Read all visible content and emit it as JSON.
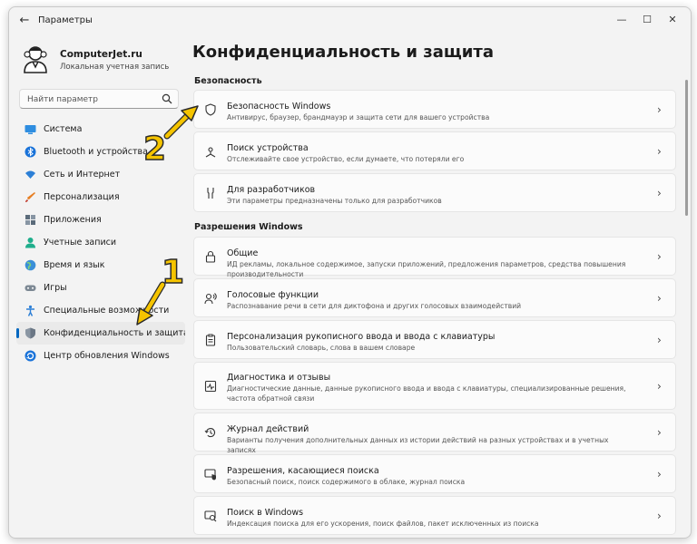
{
  "window": {
    "title": "Параметры",
    "back_icon": "back-arrow-icon",
    "controls": [
      "minimize-icon",
      "maximize-icon",
      "close-icon"
    ]
  },
  "profile": {
    "name": "ComputerJet.ru",
    "account_type": "Локальная учетная запись"
  },
  "search": {
    "placeholder": "Найти параметр"
  },
  "sidebar": {
    "items": [
      {
        "label": "Система",
        "icon": "system-icon"
      },
      {
        "label": "Bluetooth и устройства",
        "icon": "bluetooth-icon"
      },
      {
        "label": "Сеть и Интернет",
        "icon": "wifi-icon"
      },
      {
        "label": "Персонализация",
        "icon": "brush-icon"
      },
      {
        "label": "Приложения",
        "icon": "apps-icon"
      },
      {
        "label": "Учетные записи",
        "icon": "accounts-icon"
      },
      {
        "label": "Время и язык",
        "icon": "globe-icon"
      },
      {
        "label": "Игры",
        "icon": "gamepad-icon"
      },
      {
        "label": "Специальные возможности",
        "icon": "accessibility-icon"
      },
      {
        "label": "Конфиденциальность и защита",
        "icon": "shield-icon",
        "active": true
      },
      {
        "label": "Центр обновления Windows",
        "icon": "update-icon"
      }
    ]
  },
  "main": {
    "title": "Конфиденциальность и защита",
    "sections": [
      {
        "header": "Безопасность",
        "cards": [
          {
            "title": "Безопасность Windows",
            "desc": "Антивирус, браузер, брандмауэр и защита сети для вашего устройства",
            "icon": "shield-icon"
          },
          {
            "title": "Поиск устройства",
            "desc": "Отслеживайте свое устройство, если думаете, что потеряли его",
            "icon": "find-device-icon"
          },
          {
            "title": "Для разработчиков",
            "desc": "Эти параметры предназначены только для разработчиков",
            "icon": "developer-tools-icon"
          }
        ]
      },
      {
        "header": "Разрешения Windows",
        "cards": [
          {
            "title": "Общие",
            "desc": "ИД рекламы, локальное содержимое, запуски приложений, предложения параметров, средства повышения производительности",
            "icon": "lock-icon"
          },
          {
            "title": "Голосовые функции",
            "desc": "Распознавание речи в сети для диктофона и других голосовых взаимодействий",
            "icon": "speech-icon"
          },
          {
            "title": "Персонализация рукописного ввода и ввода с клавиатуры",
            "desc": "Пользовательский словарь, слова в вашем словаре",
            "icon": "clipboard-icon"
          },
          {
            "title": "Диагностика и отзывы",
            "desc": "Диагностические данные, данные рукописного ввода и ввода с клавиатуры, специализированные решения, частота обратной связи",
            "icon": "diagnostics-icon"
          },
          {
            "title": "Журнал действий",
            "desc": "Варианты получения дополнительных данных из истории действий на разных устройствах и в учетных записях",
            "icon": "history-icon"
          },
          {
            "title": "Разрешения, касающиеся поиска",
            "desc": "Безопасный поиск, поиск содержимого в облаке, журнал поиска",
            "icon": "search-permissions-icon"
          },
          {
            "title": "Поиск в Windows",
            "desc": "Индексация поиска для его ускорения, поиск файлов, пакет исключенных из поиска",
            "icon": "search-windows-icon"
          }
        ]
      }
    ]
  },
  "annotations": [
    {
      "label": "1",
      "color": "#f5c400"
    },
    {
      "label": "2",
      "color": "#f5c400"
    }
  ],
  "colors": {
    "accent": "#0067c0",
    "window_bg": "#f3f3f3",
    "card_bg": "#fbfbfb",
    "annotation": "#f5c400"
  }
}
